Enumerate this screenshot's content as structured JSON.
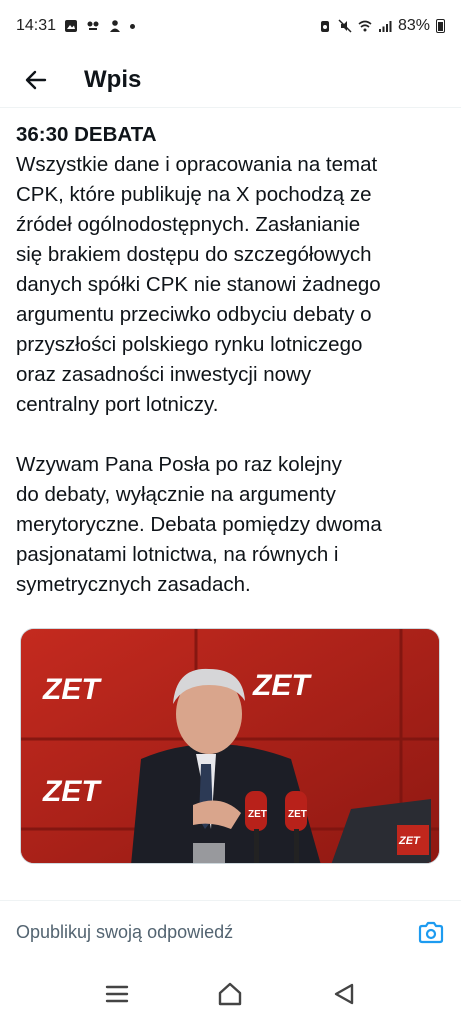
{
  "status_bar": {
    "time": "14:31",
    "battery": "83%"
  },
  "header": {
    "title": "Wpis"
  },
  "post": {
    "title": "36:30 DEBATA",
    "paragraphs": [
      [
        "Wszystkie dane i opracowania na temat",
        "CPK, które publikuję na X pochodzą ze",
        "źródeł ogólnodostępnych. Zasłanianie",
        "się brakiem dostępu do szczegółowych",
        "danych spółki CPK nie stanowi żadnego",
        "argumentu przeciwko odbyciu debaty o",
        "przyszłości polskiego rynku lotniczego",
        "oraz zasadności inwestycji nowy",
        "centralny port lotniczy."
      ],
      [
        "Wzywam Pana Posła po raz kolejny",
        "do debaty, wyłącznie na argumenty",
        "merytoryczne. Debata pomiędzy dwoma",
        "pasjonatami lotnictwa, na równych i",
        "symetrycznych zasadach."
      ]
    ]
  },
  "media": {
    "logo_text": "ZET"
  },
  "reply": {
    "placeholder": "Opublikuj swoją odpowiedź"
  },
  "colors": {
    "accent": "#1d9bf0",
    "zet_red": "#c0271d"
  }
}
